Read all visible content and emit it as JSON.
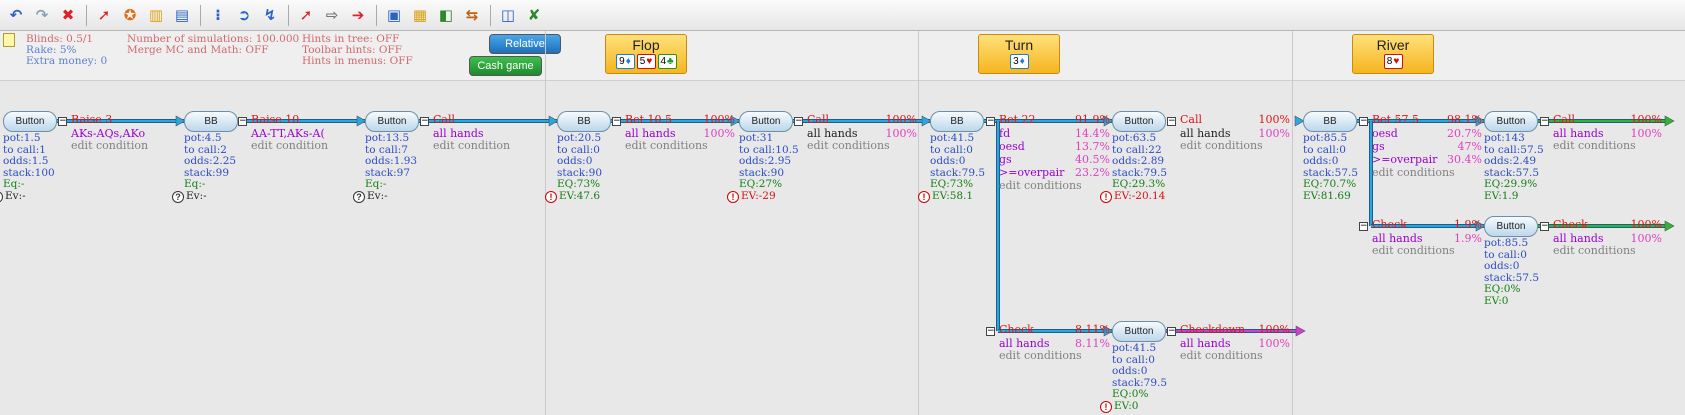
{
  "toolbar": {
    "icons": [
      "undo-icon",
      "redo-icon",
      "delete-icon",
      "sep",
      "add-action-icon",
      "settings-icon",
      "chart-icon",
      "export-icon",
      "sep",
      "range-icon",
      "forward-circle-icon",
      "spin-icon",
      "sep",
      "pin-icon",
      "arrow-outline-icon",
      "arrow-right-icon",
      "sep",
      "card-icon",
      "grid-icon",
      "equity-icon",
      "swap-icon",
      "sep",
      "report-icon",
      "excel-icon"
    ]
  },
  "info": {
    "blinds": "Blinds: 0.5/1",
    "rake": "Rake: 5%",
    "extra": "Extra money: 0",
    "sims": "Number of simulations: 100.000",
    "merge": "Merge MC and Math: OFF",
    "hints_tree": "Hints in tree: OFF",
    "hints_toolbar": "Toolbar hints: OFF",
    "hints_menus": "Hints in menus: OFF",
    "btn_relative": "Relative",
    "btn_cash": "Cash game"
  },
  "streets": [
    {
      "name": "Flop",
      "cards": [
        {
          "rank": "9",
          "suit": "♦"
        },
        {
          "rank": "5",
          "suit": "♥"
        },
        {
          "rank": "4",
          "suit": "♣"
        }
      ]
    },
    {
      "name": "Turn",
      "cards": [
        {
          "rank": "3",
          "suit": "♦"
        }
      ]
    },
    {
      "name": "River",
      "cards": [
        {
          "rank": "8",
          "suit": "♥"
        }
      ]
    }
  ],
  "players": {
    "n1": "Button",
    "n2": "BB",
    "n3": "Button",
    "n4": "BB",
    "n5": "Button",
    "n6": "BB",
    "n7": "Button",
    "n8": "Button",
    "n9": "BB",
    "n10": "Button",
    "n11": "Button"
  },
  "actions": {
    "a1": {
      "label": "Raise 3",
      "range": "AKs-AQs,AKo",
      "cond": "edit condition"
    },
    "a2": {
      "label": "Raise 10",
      "range": "AA-TT,AKs-A(",
      "cond": "edit condition"
    },
    "a3": {
      "label": "Call",
      "range": "all hands",
      "cond": "edit condition"
    },
    "a4": {
      "label": "Bet 10.5",
      "pct": "100%",
      "range": "all hands",
      "rpct": "100%",
      "cond": "edit conditions"
    },
    "a5": {
      "label": "Call",
      "pct": "100%",
      "range": "all hands",
      "rpct": "100%",
      "cond": "edit conditions"
    },
    "a6": {
      "label": "Bet 22",
      "pct": "91.9%",
      "c1": "fd",
      "p1": "14.4%",
      "c2": "oesd",
      "p2": "13.7%",
      "c3": "gs",
      "p3": "40.5%",
      "c4": ">=overpair",
      "p4": "23.2%",
      "cond": "edit conditions"
    },
    "a7": {
      "label": "Check",
      "pct": "8.11%",
      "range": "all hands",
      "rpct": "8.11%",
      "cond": "edit conditions"
    },
    "a8": {
      "label": "Call",
      "pct": "100%",
      "range": "all hands",
      "rpct": "100%",
      "cond": "edit conditions"
    },
    "a9": {
      "label": "Checkdown",
      "pct": "100%",
      "range": "all hands",
      "rpct": "100%",
      "cond": "edit conditions"
    },
    "a10": {
      "label": "Bet 57.5",
      "pct": "98.1%",
      "c1": "oesd",
      "p1": "20.7%",
      "c2": "gs",
      "p2": "47%",
      "c3": ">=overpair",
      "p3": "30.4%",
      "cond": "edit conditions"
    },
    "a11": {
      "label": "Check",
      "pct": "1.9%",
      "range": "all hands",
      "rpct": "1.9%",
      "cond": "edit conditions"
    },
    "a12": {
      "label": "Call",
      "pct": "100%",
      "range": "all hands",
      "rpct": "100%",
      "cond": "edit conditions"
    },
    "a13": {
      "label": "Check",
      "pct": "100%",
      "range": "all hands",
      "rpct": "100%",
      "cond": "edit conditions"
    }
  },
  "stats": {
    "s1": {
      "pot": "pot:1.5",
      "tocall": "to call:1",
      "odds": "odds:1.5",
      "stack": "stack:100",
      "eq": "Eq:-",
      "ev": "Ev:-"
    },
    "s2": {
      "pot": "pot:4.5",
      "tocall": "to call:2",
      "odds": "odds:2.25",
      "stack": "stack:99",
      "eq": "Eq:-",
      "ev": "Ev:-"
    },
    "s3": {
      "pot": "pot:13.5",
      "tocall": "to call:7",
      "odds": "odds:1.93",
      "stack": "stack:97",
      "eq": "Eq:-",
      "ev": "Ev:-"
    },
    "s4": {
      "pot": "pot:20.5",
      "tocall": "to call:0",
      "odds": "odds:0",
      "stack": "stack:90",
      "eq": "EQ:73%",
      "ev": "EV:47.6"
    },
    "s5": {
      "pot": "pot:31",
      "tocall": "to call:10.5",
      "odds": "odds:2.95",
      "stack": "stack:90",
      "eq": "EQ:27%",
      "ev": "EV:-29"
    },
    "s6": {
      "pot": "pot:41.5",
      "tocall": "to call:0",
      "odds": "odds:0",
      "stack": "stack:79.5",
      "eq": "EQ:73%",
      "ev": "EV:58.1"
    },
    "s7": {
      "pot": "pot:63.5",
      "tocall": "to call:22",
      "odds": "odds:2.89",
      "stack": "stack:79.5",
      "eq": "EQ:29.3%",
      "ev": "EV:-20.14"
    },
    "s8": {
      "pot": "pot:41.5",
      "tocall": "to call:0",
      "odds": "odds:0",
      "stack": "stack:79.5",
      "eq": "EQ:0%",
      "ev": "EV:0"
    },
    "s9": {
      "pot": "pot:85.5",
      "tocall": "to call:0",
      "odds": "odds:0",
      "stack": "stack:57.5",
      "eq": "EQ:70.7%",
      "ev": "EV:81.69"
    },
    "s10": {
      "pot": "pot:143",
      "tocall": "to call:57.5",
      "odds": "odds:2.49",
      "stack": "stack:57.5",
      "eq": "EQ:29.9%",
      "ev": "EV:1.9"
    },
    "s11": {
      "pot": "pot:85.5",
      "tocall": "to call:0",
      "odds": "odds:0",
      "stack": "stack:57.5",
      "eq": "EQ:0%",
      "ev": "EV:0"
    }
  },
  "colors": {
    "line_blue": "#29a7e1",
    "line_green": "#2fb52f",
    "line_magenta": "#d040d0",
    "action_red": "#e01515",
    "stat_blue": "#2c4dc6",
    "stat_green": "#137f13",
    "street_gold": "#f5b520"
  }
}
